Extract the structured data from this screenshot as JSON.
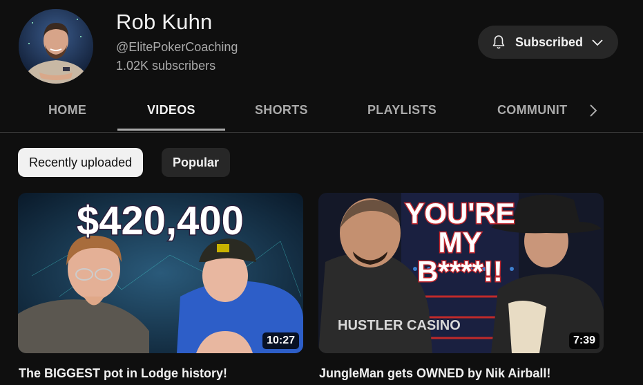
{
  "channel": {
    "name": "Rob Kuhn",
    "handle": "@ElitePokerCoaching",
    "subscribers": "1.02K subscribers",
    "subscribe_label": "Subscribed"
  },
  "tabs": [
    {
      "label": "HOME",
      "active": false
    },
    {
      "label": "VIDEOS",
      "active": true
    },
    {
      "label": "SHORTS",
      "active": false
    },
    {
      "label": "PLAYLISTS",
      "active": false
    },
    {
      "label": "COMMUNITY",
      "active": false
    }
  ],
  "filters": {
    "recent": "Recently uploaded",
    "popular": "Popular",
    "selected": "Recently uploaded"
  },
  "videos": [
    {
      "title": "The BIGGEST pot in Lodge history!",
      "duration": "10:27",
      "thumb_text": "$420,400"
    },
    {
      "title": "JungleMan gets OWNED by Nik Airball!",
      "duration": "7:39",
      "thumb_text_1": "YOU'RE",
      "thumb_text_2": "MY",
      "thumb_text_3": "B****!!",
      "shirt_text": "HUSTLER CASINO"
    }
  ],
  "icons": {
    "bell": "bell-icon",
    "chevron_down": "chevron-down-icon",
    "chevron_right": "chevron-right-icon"
  },
  "colors": {
    "background": "#0f0f0f",
    "surface": "#272727",
    "text_primary": "#f1f1f1",
    "text_secondary": "#aaaaaa"
  }
}
